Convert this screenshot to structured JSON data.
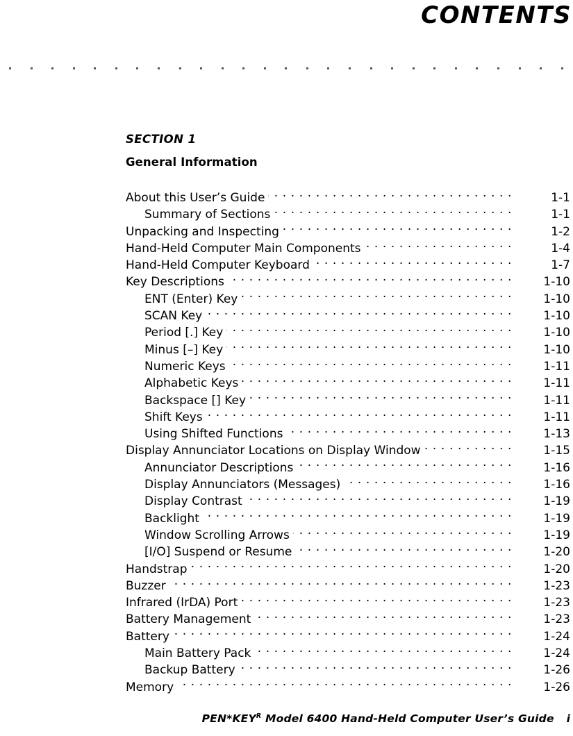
{
  "header": {
    "title": "CONTENTS"
  },
  "rule": {
    "dot_count": 27
  },
  "section": {
    "label": "SECTION 1",
    "name": "General Information"
  },
  "toc": {
    "entries": [
      {
        "title": "About this User’s Guide",
        "page": "1-1",
        "level": 1
      },
      {
        "title": "Summary of Sections",
        "page": "1-1",
        "level": 2
      },
      {
        "title": "Unpacking and Inspecting",
        "page": "1-2",
        "level": 1
      },
      {
        "title": "Hand-Held Computer Main Components",
        "page": "1-4",
        "level": 1
      },
      {
        "title": "Hand-Held Computer Keyboard",
        "page": "1-7",
        "level": 1
      },
      {
        "title": "Key Descriptions",
        "page": "1-10",
        "level": 1
      },
      {
        "title": "ENT (Enter) Key",
        "page": "1-10",
        "level": 2
      },
      {
        "title": "SCAN Key",
        "page": "1-10",
        "level": 2
      },
      {
        "title": "Period [.] Key",
        "page": "1-10",
        "level": 2
      },
      {
        "title": "Minus [–] Key",
        "page": "1-10",
        "level": 2
      },
      {
        "title": "Numeric Keys",
        "page": "1-11",
        "level": 2
      },
      {
        "title": "Alphabetic Keys",
        "page": "1-11",
        "level": 2
      },
      {
        "title": "Backspace [] Key",
        "page": "1-11",
        "level": 2
      },
      {
        "title": "Shift Keys",
        "page": "1-11",
        "level": 2
      },
      {
        "title": "Using Shifted Functions",
        "page": "1-13",
        "level": 2
      },
      {
        "title": "Display Annunciator Locations on Display Window",
        "page": "1-15",
        "level": 1
      },
      {
        "title": "Annunciator Descriptions",
        "page": "1-16",
        "level": 2
      },
      {
        "title": "Display Annunciators (Messages)",
        "page": "1-16",
        "level": 2
      },
      {
        "title": "Display Contrast",
        "page": "1-19",
        "level": 2
      },
      {
        "title": "Backlight",
        "page": "1-19",
        "level": 2
      },
      {
        "title": "Window Scrolling Arrows",
        "page": "1-19",
        "level": 2
      },
      {
        "title": "[I/O] Suspend or Resume",
        "page": "1-20",
        "level": 2
      },
      {
        "title": "Handstrap",
        "page": "1-20",
        "level": 1
      },
      {
        "title": "Buzzer",
        "page": "1-23",
        "level": 1
      },
      {
        "title": "Infrared (IrDA) Port",
        "page": "1-23",
        "level": 1
      },
      {
        "title": "Battery Management",
        "page": "1-23",
        "level": 1
      },
      {
        "title": "Battery",
        "page": "1-24",
        "level": 1
      },
      {
        "title": "Main Battery Pack",
        "page": "1-24",
        "level": 2
      },
      {
        "title": "Backup Battery",
        "page": "1-26",
        "level": 2
      },
      {
        "title": "Memory",
        "page": "1-26",
        "level": 1
      }
    ]
  },
  "footer": {
    "product": "PEN*KEY",
    "trademark": "R",
    "doc_title": " Model 6400 Hand-Held Computer User’s Guide",
    "page_number": "i"
  }
}
